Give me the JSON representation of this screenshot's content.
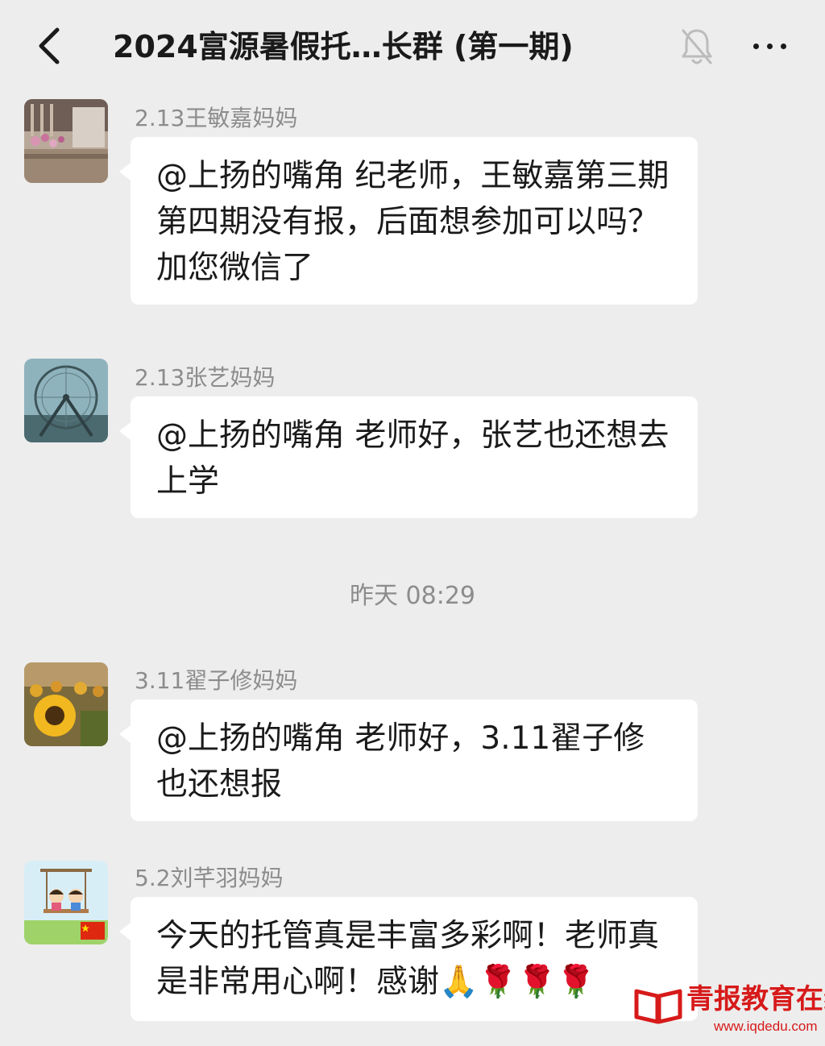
{
  "header": {
    "title": "2024富源暑假托…长群 (第一期)"
  },
  "messages": [
    {
      "sender": "2.13王敏嘉妈妈",
      "text": "@上扬的嘴角  纪老师，王敏嘉第三期第四期没有报，后面想参加可以吗？加您微信了"
    },
    {
      "sender": "2.13张艺妈妈",
      "text": "@上扬的嘴角  老师好，张艺也还想去上学"
    },
    {
      "sender": "3.11翟子修妈妈",
      "text": "@上扬的嘴角  老师好，3.11翟子修也还想报"
    },
    {
      "sender": "5.2刘芊羽妈妈",
      "text": "今天的托管真是丰富多彩啊！老师真是非常用心啊！感谢🙏🌹🌹🌹"
    }
  ],
  "time_separator": "昨天 08:29",
  "watermark": {
    "brand": "青报教育在线",
    "url": "www.iqdedu.com"
  },
  "colors": {
    "background": "#ededed",
    "bubble": "#ffffff",
    "text": "#1a1a1a",
    "meta": "#8c8c8c",
    "watermark": "#d71a1a"
  }
}
